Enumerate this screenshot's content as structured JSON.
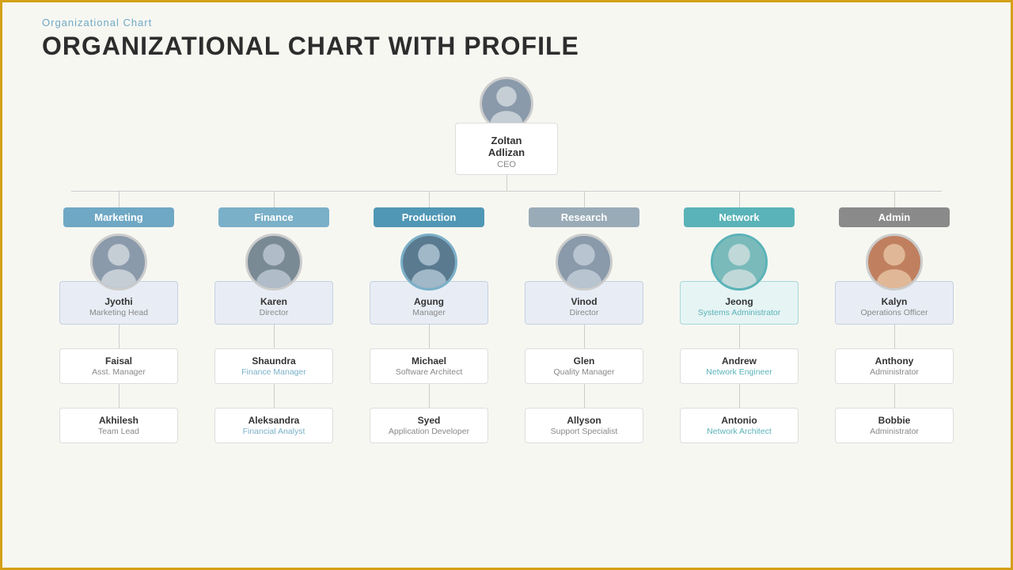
{
  "header": {
    "subtitle": "Organizational  Chart",
    "title": "ORGANIZATIONAL CHART WITH PROFILE"
  },
  "ceo": {
    "name": "Zoltan Adlizan",
    "title": "CEO"
  },
  "departments": [
    {
      "id": "marketing",
      "label": "Marketing",
      "color": "bg-marketing",
      "head": {
        "name": "Jyothi",
        "title": "Marketing Head"
      },
      "level2": {
        "name": "Faisal",
        "title": "Asst. Manager",
        "titleColor": "gray"
      },
      "level3": {
        "name": "Akhilesh",
        "title": "Team Lead",
        "titleColor": "gray"
      }
    },
    {
      "id": "finance",
      "label": "Finance",
      "color": "bg-finance",
      "head": {
        "name": "Karen",
        "title": "Director"
      },
      "level2": {
        "name": "Shaundra",
        "title": "Finance Manager",
        "titleColor": "blue"
      },
      "level3": {
        "name": "Aleksandra",
        "title": "Financial Analyst",
        "titleColor": "blue"
      }
    },
    {
      "id": "production",
      "label": "Production",
      "color": "bg-production",
      "head": {
        "name": "Agung",
        "title": "Manager"
      },
      "level2": {
        "name": "Michael",
        "title": "Software Architect",
        "titleColor": "gray"
      },
      "level3": {
        "name": "Syed",
        "title": "Application Developer",
        "titleColor": "gray"
      }
    },
    {
      "id": "research",
      "label": "Research",
      "color": "bg-research",
      "head": {
        "name": "Vinod",
        "title": "Director"
      },
      "level2": {
        "name": "Glen",
        "title": "Quality Manager",
        "titleColor": "gray"
      },
      "level3": {
        "name": "Allyson",
        "title": "Support Specialist",
        "titleColor": "gray"
      }
    },
    {
      "id": "network",
      "label": "Network",
      "color": "bg-network",
      "head": {
        "name": "Jeong",
        "title": "Systems Administrator",
        "titleColor": "teal"
      },
      "level2": {
        "name": "Andrew",
        "title": "Network Engineer",
        "titleColor": "teal"
      },
      "level3": {
        "name": "Antonio",
        "title": "Network Architect",
        "titleColor": "teal"
      }
    },
    {
      "id": "admin",
      "label": "Admin",
      "color": "bg-admin",
      "head": {
        "name": "Kalyn",
        "title": "Operations Officer"
      },
      "level2": {
        "name": "Anthony",
        "title": "Administrator",
        "titleColor": "gray"
      },
      "level3": {
        "name": "Bobbie",
        "title": "Administrator",
        "titleColor": "gray"
      }
    }
  ]
}
